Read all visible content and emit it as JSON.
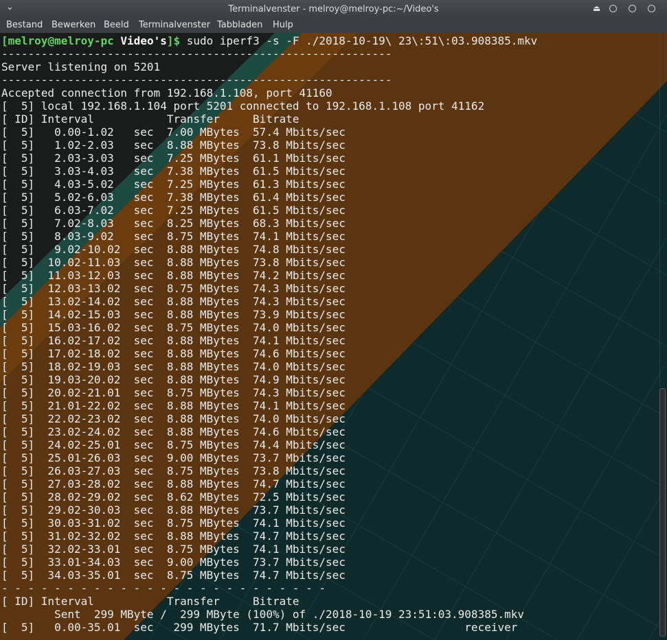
{
  "window": {
    "title": "Terminalvenster - melroy@melroy-pc:~/Video's"
  },
  "menu": [
    "Bestand",
    "Bewerken",
    "Beeld",
    "Terminalvenster",
    "Tabbladen",
    "Hulp"
  ],
  "prompt": {
    "open": "[",
    "user_host": "melroy@melroy-pc",
    "dir": "Video's",
    "close": "]$",
    "command": "sudo iperf3 -s -F ./2018-10-19\\ 23\\:51\\:03.908385.mkv"
  },
  "output_lines": [
    "-----------------------------------------------------------",
    "Server listening on 5201",
    "-----------------------------------------------------------",
    "Accepted connection from 192.168.1.108, port 41160",
    "[  5] local 192.168.1.104 port 5201 connected to 192.168.1.108 port 41162",
    "[ ID] Interval           Transfer     Bitrate",
    "[  5]   0.00-1.02   sec  7.00 MBytes  57.4 Mbits/sec",
    "[  5]   1.02-2.03   sec  8.88 MBytes  73.8 Mbits/sec",
    "[  5]   2.03-3.03   sec  7.25 MBytes  61.1 Mbits/sec",
    "[  5]   3.03-4.03   sec  7.38 MBytes  61.5 Mbits/sec",
    "[  5]   4.03-5.02   sec  7.25 MBytes  61.3 Mbits/sec",
    "[  5]   5.02-6.03   sec  7.38 MBytes  61.4 Mbits/sec",
    "[  5]   6.03-7.02   sec  7.25 MBytes  61.5 Mbits/sec",
    "[  5]   7.02-8.03   sec  8.25 MBytes  68.3 Mbits/sec",
    "[  5]   8.03-9.02   sec  8.75 MBytes  74.1 Mbits/sec",
    "[  5]   9.02-10.02  sec  8.88 MBytes  74.8 Mbits/sec",
    "[  5]  10.02-11.03  sec  8.88 MBytes  73.8 Mbits/sec",
    "[  5]  11.03-12.03  sec  8.88 MBytes  74.2 Mbits/sec",
    "[  5]  12.03-13.02  sec  8.75 MBytes  74.3 Mbits/sec",
    "[  5]  13.02-14.02  sec  8.88 MBytes  74.3 Mbits/sec",
    "[  5]  14.02-15.03  sec  8.88 MBytes  73.9 Mbits/sec",
    "[  5]  15.03-16.02  sec  8.75 MBytes  74.0 Mbits/sec",
    "[  5]  16.02-17.02  sec  8.88 MBytes  74.1 Mbits/sec",
    "[  5]  17.02-18.02  sec  8.88 MBytes  74.6 Mbits/sec",
    "[  5]  18.02-19.03  sec  8.88 MBytes  74.0 Mbits/sec",
    "[  5]  19.03-20.02  sec  8.88 MBytes  74.9 Mbits/sec",
    "[  5]  20.02-21.01  sec  8.75 MBytes  74.3 Mbits/sec",
    "[  5]  21.01-22.02  sec  8.88 MBytes  74.1 Mbits/sec",
    "[  5]  22.02-23.02  sec  8.88 MBytes  74.0 Mbits/sec",
    "[  5]  23.02-24.02  sec  8.88 MBytes  74.6 Mbits/sec",
    "[  5]  24.02-25.01  sec  8.75 MBytes  74.4 Mbits/sec",
    "[  5]  25.01-26.03  sec  9.00 MBytes  73.7 Mbits/sec",
    "[  5]  26.03-27.03  sec  8.75 MBytes  73.8 Mbits/sec",
    "[  5]  27.03-28.02  sec  8.88 MBytes  74.7 Mbits/sec",
    "[  5]  28.02-29.02  sec  8.62 MBytes  72.5 Mbits/sec",
    "[  5]  29.02-30.03  sec  8.88 MBytes  73.7 Mbits/sec",
    "[  5]  30.03-31.02  sec  8.75 MBytes  74.1 Mbits/sec",
    "[  5]  31.02-32.02  sec  8.88 MBytes  74.7 Mbits/sec",
    "[  5]  32.02-33.01  sec  8.75 MBytes  74.1 Mbits/sec",
    "[  5]  33.01-34.03  sec  9.00 MBytes  73.7 Mbits/sec",
    "[  5]  34.03-35.01  sec  8.75 MBytes  74.7 Mbits/sec",
    "- - - - - - - - - - - - - - - - - - - - - - - - -",
    "[ ID] Interval           Transfer     Bitrate",
    "        Sent  299 MByte /  299 MByte (100%) of ./2018-10-19 23:51:03.908385.mkv",
    "[  5]   0.00-35.01  sec   299 MBytes  71.7 Mbits/sec                  receiver"
  ]
}
